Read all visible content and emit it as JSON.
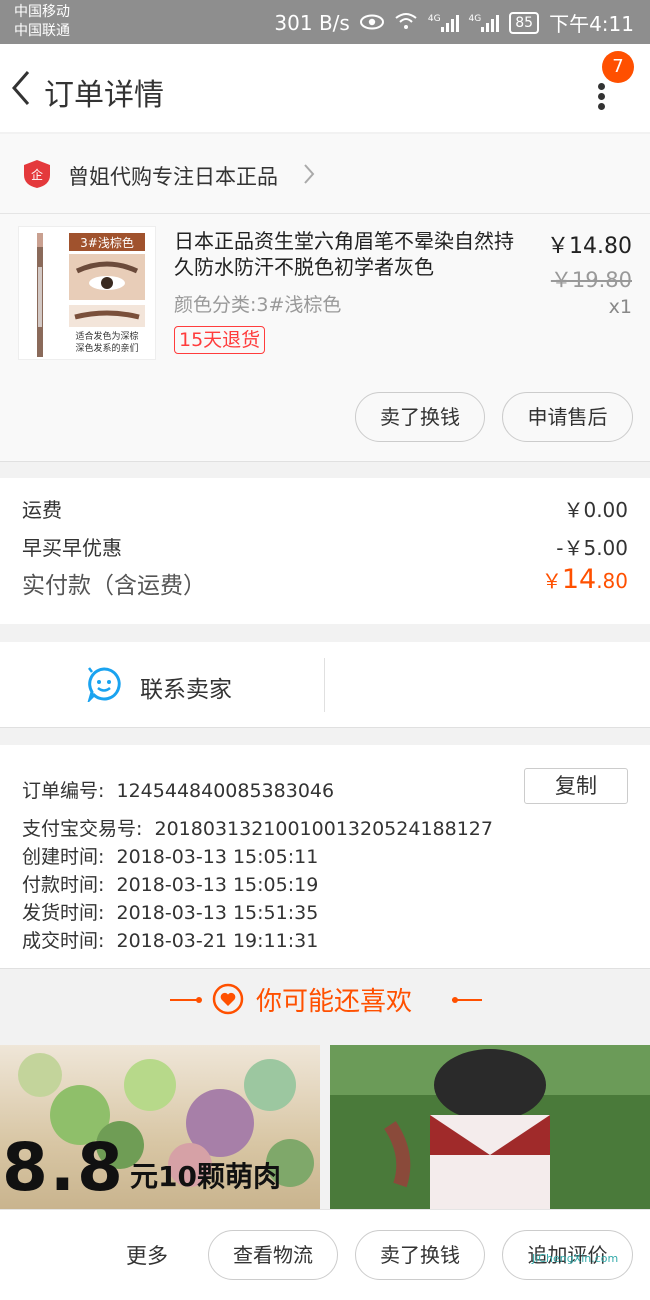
{
  "status_bar": {
    "carrier1": "中国移动",
    "carrier2": "中国联通",
    "speed": "301 B/s",
    "net1": "4G",
    "net2": "4G",
    "battery": "85",
    "time": "下午4:11"
  },
  "nav": {
    "title": "订单详情",
    "badge_count": "7"
  },
  "shop": {
    "name": "曾姐代购专注日本正品"
  },
  "product": {
    "name": "日本正品资生堂六角眉笔不晕染自然持久防水防汗不脱色初学者灰色",
    "price": "￥14.80",
    "original_price": "￥19.80",
    "quantity": "x1",
    "attribute": "颜色分类:3#浅棕色",
    "tag": "15天退货",
    "thumb_label": "3#浅棕色",
    "thumb_caption1": "适合发色为深棕",
    "thumb_caption2": "深色发系的亲们",
    "btn_sell": "卖了换钱",
    "btn_aftersale": "申请售后"
  },
  "fees": {
    "shipping_label": "运费",
    "shipping_value": "￥0.00",
    "discount_label": "早买早优惠",
    "discount_value": "-￥5.00",
    "paid_label": "实付款（含运费）",
    "paid_symbol": "￥",
    "paid_int": "14",
    "paid_dec": ".80"
  },
  "contact": {
    "label": "联系卖家"
  },
  "order": {
    "order_no_label": "订单编号:",
    "order_no": "1245448400853830​46",
    "alipay_label": "支付宝交易号:",
    "alipay_no": "2018031321001001320524188127",
    "created_label": "创建时间:",
    "created": "2018-03-13 15:05:11",
    "paid_label": "付款时间:",
    "paid": "2018-03-13 15:05:19",
    "shipped_label": "发货时间:",
    "shipped": "2018-03-13 15:51:35",
    "closed_label": "成交时间:",
    "closed": "2018-03-21 19:11:31",
    "copy_label": "复制"
  },
  "recommend": {
    "title": "你可能还喜欢",
    "promo_big": "8.8",
    "promo_small": "元10颗萌肉"
  },
  "bottom": {
    "more": "更多",
    "logistics": "查看物流",
    "sell": "卖了换钱",
    "review": "追加评价"
  },
  "watermark": {
    "domain": "JiChengXin.com"
  },
  "colors": {
    "accent": "#ff5000",
    "tag_red": "#ff3c3c",
    "contact_blue": "#1aa3f0"
  }
}
